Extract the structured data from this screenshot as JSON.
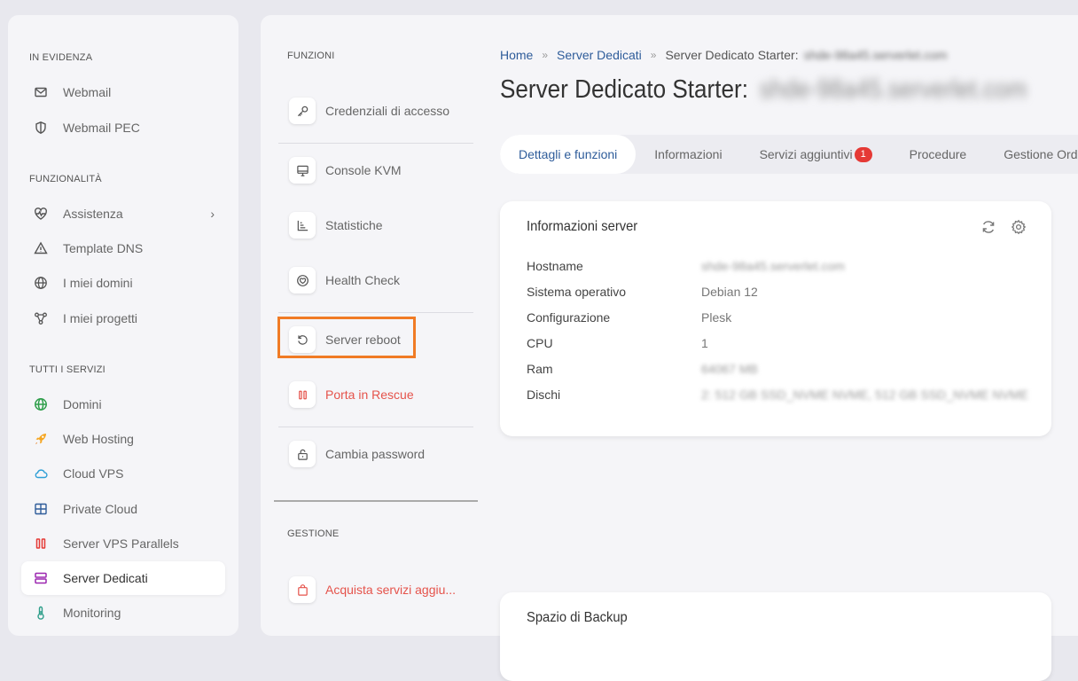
{
  "sidebar": {
    "sections": [
      {
        "title": "IN EVIDENZA"
      },
      {
        "title": "FUNZIONALITÀ"
      },
      {
        "title": "TUTTI I SERVIZI"
      }
    ],
    "items": [
      {
        "label": "Webmail",
        "icon": "mail-icon"
      },
      {
        "label": "Webmail PEC",
        "icon": "shield-icon"
      },
      {
        "label": "Assistenza",
        "icon": "heart-pulse-icon"
      },
      {
        "label": "Template DNS",
        "icon": "warning-triangle-icon"
      },
      {
        "label": "I miei domini",
        "icon": "globe-icon"
      },
      {
        "label": "I miei progetti",
        "icon": "share-nodes-icon"
      },
      {
        "label": "Domini",
        "icon": "green-globe-icon"
      },
      {
        "label": "Web Hosting",
        "icon": "rocket-icon"
      },
      {
        "label": "Cloud VPS",
        "icon": "cloud-icon"
      },
      {
        "label": "Private Cloud",
        "icon": "grid-icon"
      },
      {
        "label": "Server VPS Parallels",
        "icon": "parallels-icon"
      },
      {
        "label": "Server Dedicati",
        "icon": "server-icon"
      },
      {
        "label": "Monitoring",
        "icon": "thermometer-icon"
      }
    ]
  },
  "functions": {
    "title": "FUNZIONI",
    "items": [
      {
        "label": "Credenziali di accesso",
        "icon": "key-icon"
      },
      {
        "label": "Console KVM",
        "icon": "monitor-icon"
      },
      {
        "label": "Statistiche",
        "icon": "chart-icon"
      },
      {
        "label": "Health Check",
        "icon": "heart-icon"
      },
      {
        "label": "Server reboot",
        "icon": "reboot-icon"
      },
      {
        "label": "Porta in Rescue",
        "icon": "rescue-icon"
      },
      {
        "label": "Cambia password",
        "icon": "lock-icon"
      }
    ],
    "management_title": "GESTIONE",
    "management_items": [
      {
        "label": "Acquista servizi aggiu...",
        "icon": "shopping-bag-icon"
      }
    ]
  },
  "breadcrumb": {
    "home": "Home",
    "section": "Server Dedicati",
    "current": "Server Dedicato Starter:",
    "current_hidden": "shde-98a45.serverlet.com"
  },
  "page": {
    "title": "Server Dedicato Starter:",
    "title_hidden": "shde-98a45.serverlet.com"
  },
  "tabs": [
    {
      "label": "Dettagli e funzioni"
    },
    {
      "label": "Informazioni"
    },
    {
      "label": "Servizi aggiuntivi",
      "badge": "1"
    },
    {
      "label": "Procedure"
    },
    {
      "label": "Gestione Ordini"
    }
  ],
  "server_info": {
    "title": "Informazioni server",
    "rows": [
      {
        "key": "Hostname",
        "value": "shde-98a45.serverlet.com"
      },
      {
        "key": "Sistema operativo",
        "value": "Debian 12"
      },
      {
        "key": "Configurazione",
        "value": "Plesk"
      },
      {
        "key": "CPU",
        "value": "1"
      },
      {
        "key": "Ram",
        "value": "64067 MB"
      },
      {
        "key": "Dischi",
        "value": "2: 512 GB SSD_NVME NVME, 512 GB SSD_NVME NVME"
      }
    ]
  },
  "backup": {
    "title": "Spazio di Backup"
  },
  "colors": {
    "accent": "#2e5c9a",
    "highlight": "#f07b25",
    "danger": "#e5534b",
    "badge": "#e53935"
  }
}
